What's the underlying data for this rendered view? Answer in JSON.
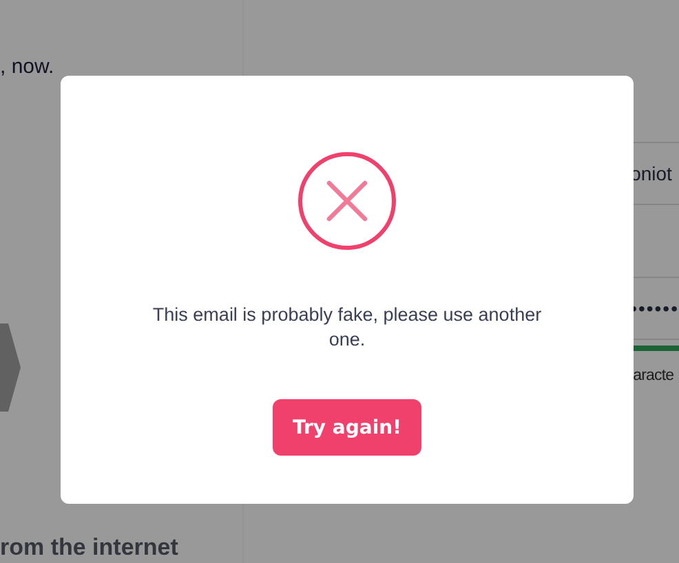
{
  "background": {
    "heading_fragment": ", now.",
    "username_field": {
      "value": "oniot"
    },
    "password_field": {
      "value": "••••••"
    },
    "password_strength": {
      "level": 1
    },
    "hint_fragment": "aracte",
    "footer_fragment": "rom the internet"
  },
  "modal": {
    "kind": "error",
    "message": "This email is probably fake, please use another one.",
    "button": "Try again!"
  }
}
